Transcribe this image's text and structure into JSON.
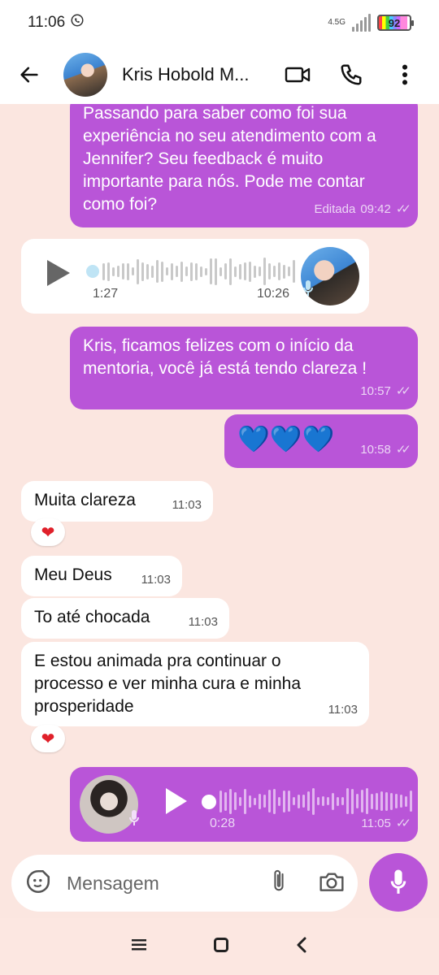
{
  "status_bar": {
    "time": "11:06",
    "network": "4.5G",
    "battery": "92"
  },
  "header": {
    "contact_name": "Kris Hobold M...",
    "icons": [
      "back-arrow-icon",
      "video-call-icon",
      "phone-icon",
      "more-icon"
    ]
  },
  "messages": [
    {
      "dir": "out",
      "type": "text",
      "text": "Passando para saber como foi sua experiência no seu atendimento com a Jennifer? Seu feedback é muito importante para nós. Pode me contar como foi?",
      "edited": "Editada",
      "time": "09:42"
    },
    {
      "dir": "in",
      "type": "audio",
      "duration": "1:27",
      "time": "10:26"
    },
    {
      "dir": "out",
      "type": "text",
      "text": "Kris, ficamos felizes com o início da mentoria, você já está tendo clareza !",
      "time": "10:57"
    },
    {
      "dir": "out",
      "type": "emoji",
      "text": "💙💙💙",
      "time": "10:58"
    },
    {
      "dir": "in",
      "type": "text",
      "text": "Muita clareza",
      "time": "11:03",
      "reaction": "❤"
    },
    {
      "dir": "in",
      "type": "text",
      "text": "Meu Deus",
      "time": "11:03"
    },
    {
      "dir": "in",
      "type": "text",
      "text": "To até chocada",
      "time": "11:03"
    },
    {
      "dir": "in",
      "type": "text",
      "text": "E estou animada pra continuar o processo e ver minha cura e minha prosperidade",
      "time": "11:03",
      "reaction": "❤"
    },
    {
      "dir": "out",
      "type": "audio",
      "duration": "0:28",
      "time": "11:05"
    }
  ],
  "input": {
    "placeholder": "Mensagem"
  },
  "colors": {
    "outgoing_bubble": "#b955d8",
    "background": "#fbe6e0"
  }
}
